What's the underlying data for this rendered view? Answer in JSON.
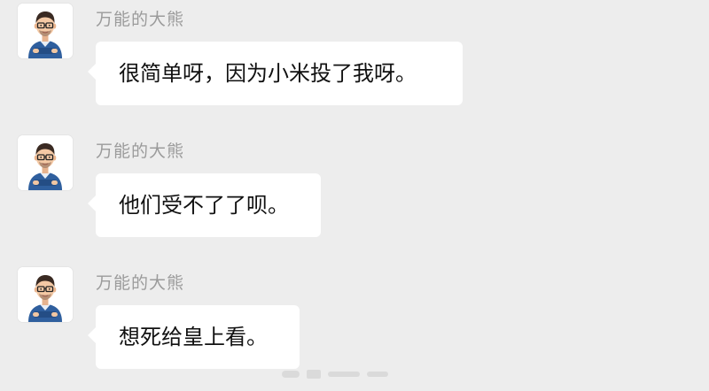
{
  "chat": {
    "messages": [
      {
        "sender": "万能的大熊",
        "text": "很简单呀，因为小米投了我呀。",
        "avatar_icon": "cartoon-man-avatar-icon"
      },
      {
        "sender": "万能的大熊",
        "text": "他们受不了了呗。",
        "avatar_icon": "cartoon-man-avatar-icon"
      },
      {
        "sender": "万能的大熊",
        "text": "想死给皇上看。",
        "avatar_icon": "cartoon-man-avatar-icon"
      }
    ]
  },
  "colors": {
    "background": "#ededed",
    "bubble": "#ffffff",
    "sender_name": "#9b9b9b",
    "message_text": "#111111"
  }
}
